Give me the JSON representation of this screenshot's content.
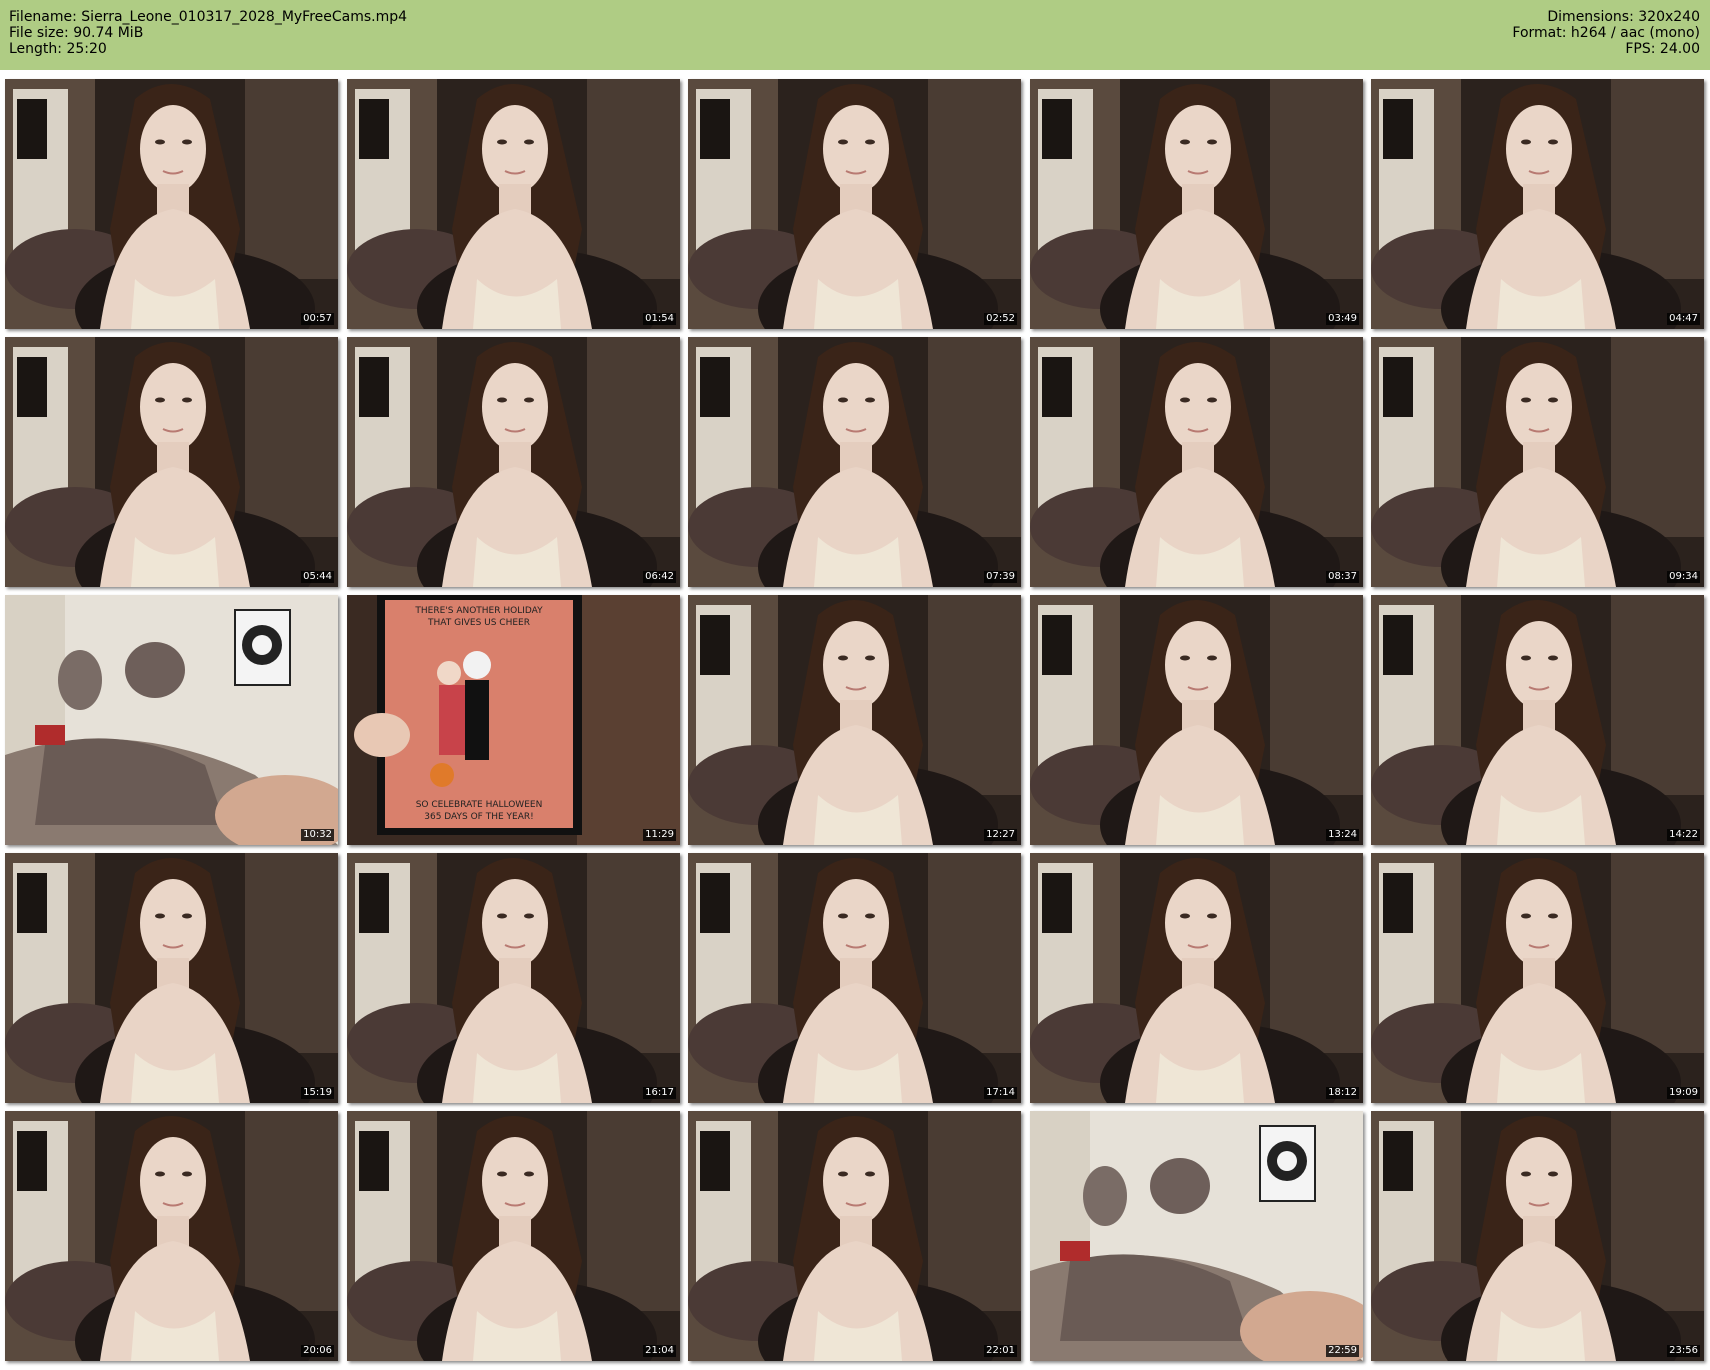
{
  "header": {
    "filename": "Filename: Sierra_Leone_010317_2028_MyFreeCams.mp4",
    "filesize": "File size: 90.74 MiB",
    "length": "Length: 25:20",
    "dimensions": "Dimensions: 320x240",
    "format": "Format: h264 / aac (mono)",
    "fps": "FPS: 24.00",
    "background_color": "#afcc84"
  },
  "thumbnails": [
    {
      "time": "00:57",
      "scene": "person"
    },
    {
      "time": "01:54",
      "scene": "person"
    },
    {
      "time": "02:52",
      "scene": "person"
    },
    {
      "time": "03:49",
      "scene": "person"
    },
    {
      "time": "04:47",
      "scene": "person"
    },
    {
      "time": "05:44",
      "scene": "person"
    },
    {
      "time": "06:42",
      "scene": "person"
    },
    {
      "time": "07:39",
      "scene": "person"
    },
    {
      "time": "08:37",
      "scene": "person"
    },
    {
      "time": "09:34",
      "scene": "person"
    },
    {
      "time": "10:32",
      "scene": "room"
    },
    {
      "time": "11:29",
      "scene": "card"
    },
    {
      "time": "12:27",
      "scene": "person"
    },
    {
      "time": "13:24",
      "scene": "person"
    },
    {
      "time": "14:22",
      "scene": "person"
    },
    {
      "time": "15:19",
      "scene": "person"
    },
    {
      "time": "16:17",
      "scene": "person"
    },
    {
      "time": "17:14",
      "scene": "person"
    },
    {
      "time": "18:12",
      "scene": "person"
    },
    {
      "time": "19:09",
      "scene": "person"
    },
    {
      "time": "20:06",
      "scene": "person"
    },
    {
      "time": "21:04",
      "scene": "person"
    },
    {
      "time": "22:01",
      "scene": "person"
    },
    {
      "time": "22:59",
      "scene": "room"
    },
    {
      "time": "23:56",
      "scene": "person"
    }
  ],
  "card_text": {
    "line1": "THERE'S ANOTHER HOLIDAY",
    "line2": "THAT GIVES US CHEER",
    "line3": "SO CELEBRATE HALLOWEEN",
    "line4": "365 DAYS OF THE YEAR!"
  }
}
